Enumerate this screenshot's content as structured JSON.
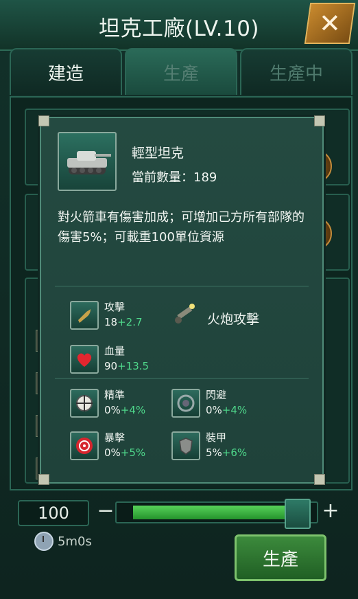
{
  "window": {
    "title": "坦克工廠(LV.10)",
    "close": "✕"
  },
  "tabs": [
    {
      "label": "建造"
    },
    {
      "label": "生產"
    },
    {
      "label": "生產中"
    }
  ],
  "unit": {
    "name": "輕型坦克",
    "count_label": "當前數量：189",
    "description": "對火箭車有傷害加成；可增加己方所有部隊的傷害5%；可載重100單位資源"
  },
  "stats": {
    "attack": {
      "label": "攻擊",
      "base": "18",
      "bonus": "+2.7"
    },
    "attack_type": "火炮攻擊",
    "hp": {
      "label": "血量",
      "base": "90",
      "bonus": "+13.5"
    },
    "accuracy": {
      "label": "精準",
      "base": "0%",
      "bonus": "+4%"
    },
    "dodge": {
      "label": "閃避",
      "base": "0%",
      "bonus": "+4%"
    },
    "crit": {
      "label": "暴擊",
      "base": "0%",
      "bonus": "+5%"
    },
    "armor": {
      "label": "裝甲",
      "base": "5%",
      "bonus": "+6%"
    }
  },
  "production": {
    "quantity": "100",
    "slider_fraction": 0.95,
    "minus": "−",
    "plus": "+",
    "time": "5m0s",
    "button": "生產"
  },
  "colors": {
    "bonus": "#4fd88b",
    "accent": "#2b6655"
  }
}
